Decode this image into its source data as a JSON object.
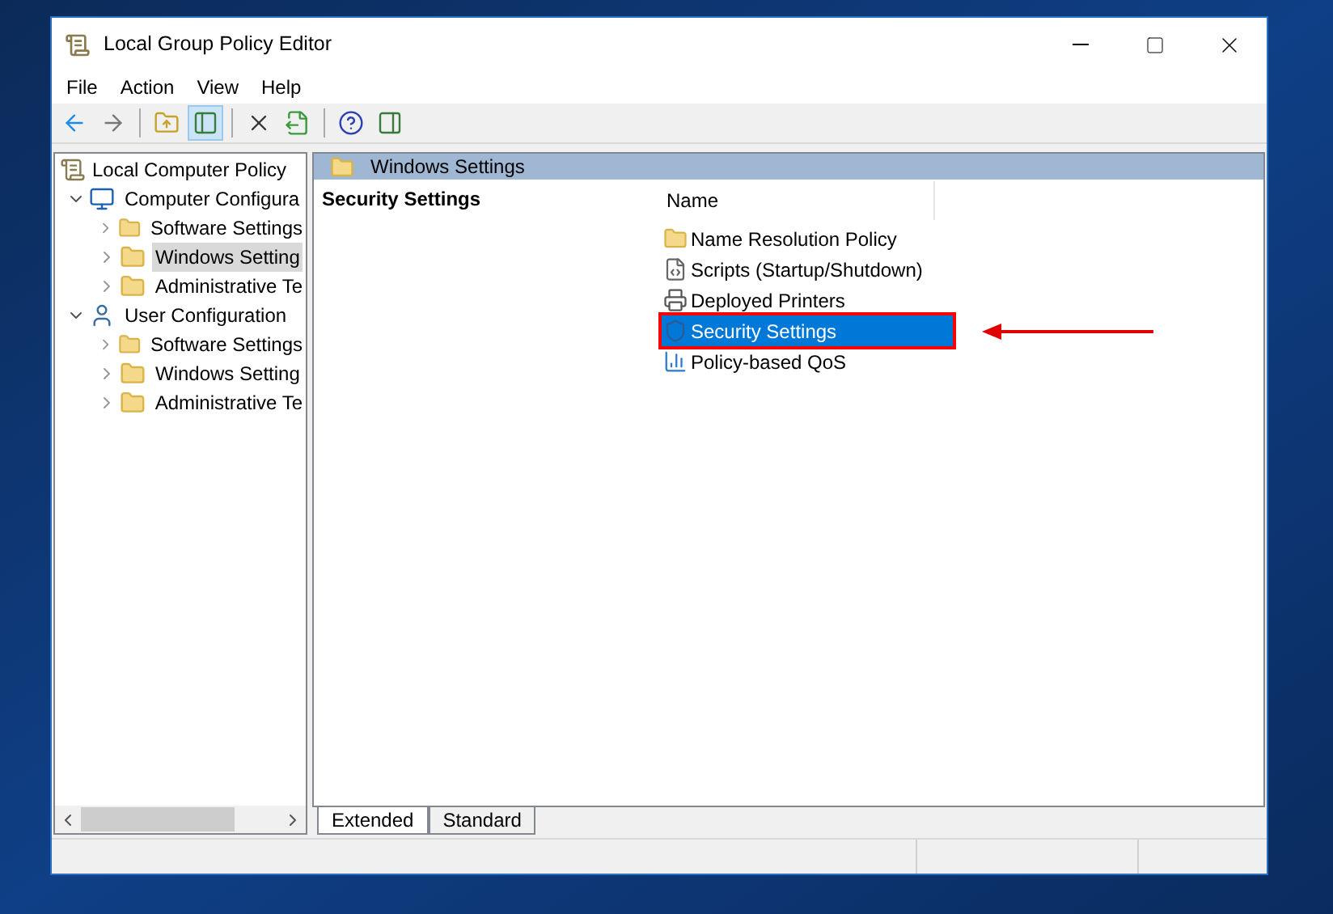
{
  "window": {
    "title": "Local Group Policy Editor"
  },
  "menu": [
    "File",
    "Action",
    "View",
    "Help"
  ],
  "toolbar": [
    {
      "kind": "back",
      "pressed": false
    },
    {
      "kind": "forward",
      "pressed": false
    },
    {
      "kind": "sep"
    },
    {
      "kind": "up",
      "pressed": false
    },
    {
      "kind": "tree",
      "pressed": true
    },
    {
      "kind": "sep"
    },
    {
      "kind": "delete",
      "pressed": false
    },
    {
      "kind": "export",
      "pressed": false
    },
    {
      "kind": "sep"
    },
    {
      "kind": "help",
      "pressed": false
    },
    {
      "kind": "view",
      "pressed": false
    }
  ],
  "tree": [
    {
      "label": "Local Computer Policy",
      "kind": "policy",
      "selected": false,
      "children": [
        {
          "label": "Computer Configura",
          "kind": "computer",
          "selected": false,
          "expanded": true,
          "children": [
            {
              "label": "Software Settings",
              "kind": "folder",
              "selected": false,
              "expanded": false
            },
            {
              "label": "Windows Setting",
              "kind": "folder",
              "selected": true,
              "expanded": false
            },
            {
              "label": "Administrative Te",
              "kind": "folder",
              "selected": false,
              "expanded": false
            }
          ]
        },
        {
          "label": "User Configuration",
          "kind": "user",
          "selected": false,
          "expanded": true,
          "children": [
            {
              "label": "Software Settings",
              "kind": "folder",
              "selected": false,
              "expanded": false
            },
            {
              "label": "Windows Setting",
              "kind": "folder",
              "selected": false,
              "expanded": false
            },
            {
              "label": "Administrative Te",
              "kind": "folder",
              "selected": false,
              "expanded": false
            }
          ]
        }
      ]
    }
  ],
  "header": {
    "title": "Windows Settings"
  },
  "description": {
    "title": "Security Settings"
  },
  "list": {
    "columns": [
      "Name"
    ],
    "items": [
      {
        "label": "Name Resolution Policy",
        "kind": "folder",
        "selected": false,
        "highlighted": false
      },
      {
        "label": "Scripts (Startup/Shutdown)",
        "kind": "script",
        "selected": false,
        "highlighted": false
      },
      {
        "label": "Deployed Printers",
        "kind": "printer",
        "selected": false,
        "highlighted": false
      },
      {
        "label": "Security Settings",
        "kind": "security",
        "selected": true,
        "highlighted": true
      },
      {
        "label": "Policy-based QoS",
        "kind": "chart",
        "selected": false,
        "highlighted": false
      }
    ]
  },
  "tabs": [
    {
      "label": "Extended",
      "selected": true
    },
    {
      "label": "Standard",
      "selected": false
    }
  ]
}
